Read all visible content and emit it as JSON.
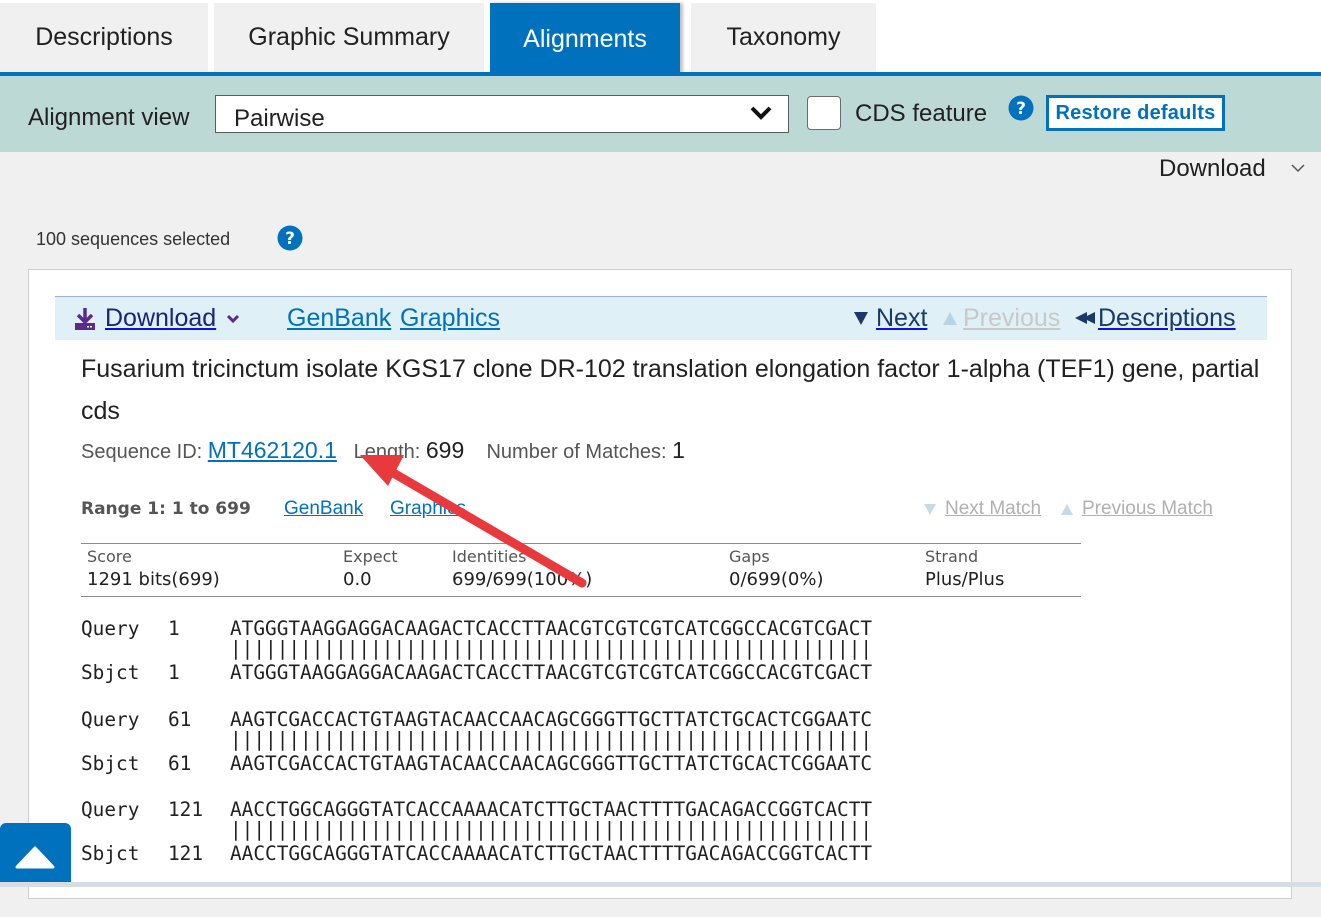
{
  "tabs": [
    {
      "label": "Descriptions",
      "active": false
    },
    {
      "label": "Graphic Summary",
      "active": false
    },
    {
      "label": "Alignments",
      "active": true
    },
    {
      "label": "Taxonomy",
      "active": false
    }
  ],
  "options": {
    "alignment_view_label": "Alignment view",
    "alignment_view_value": "Pairwise",
    "cds_feature_label": "CDS feature",
    "cds_feature_checked": false,
    "restore_defaults_label": "Restore defaults"
  },
  "download_top_label": "Download",
  "sequences_selected": "100 sequences selected",
  "hit": {
    "toolbar": {
      "download_label": "Download",
      "genbank_label": "GenBank",
      "graphics_label": "Graphics",
      "next_label": "Next",
      "previous_label": "Previous",
      "descriptions_label": "Descriptions"
    },
    "title": "Fusarium tricinctum isolate KGS17 clone DR-102 translation elongation factor 1-alpha (TEF1) gene, partial cds",
    "sequence_id_label": "Sequence ID:",
    "sequence_id": "MT462120.1",
    "length_label": "Length:",
    "length": "699",
    "matches_label": "Number of Matches:",
    "matches": "1",
    "range": {
      "label": "Range 1: 1 to 699",
      "genbank_label": "GenBank",
      "graphics_label": "Graphics",
      "next_match_label": "Next Match",
      "previous_match_label": "Previous Match"
    },
    "stats": {
      "headers": [
        "Score",
        "Expect",
        "Identities",
        "Gaps",
        "Strand"
      ],
      "values": [
        "1291 bits(699)",
        "0.0",
        "699/699(100%)",
        "0/699(0%)",
        "Plus/Plus"
      ]
    },
    "alignment": [
      {
        "query_label": "Query",
        "query_start": "1",
        "query_seq": "ATGGGTAAGGAGGACAAGACTCACCTTAACGTCGTCGTCATCGGCCACGTCGACT",
        "match": "|||||||||||||||||||||||||||||||||||||||||||||||||||||||",
        "sbjct_label": "Sbjct",
        "sbjct_start": "1",
        "sbjct_seq": "ATGGGTAAGGAGGACAAGACTCACCTTAACGTCGTCGTCATCGGCCACGTCGACT"
      },
      {
        "query_label": "Query",
        "query_start": "61",
        "query_seq": "AAGTCGACCACTGTAAGTACAACCAACAGCGGGTTGCTTATCTGCACTCGGAATC",
        "match": "|||||||||||||||||||||||||||||||||||||||||||||||||||||||",
        "sbjct_label": "Sbjct",
        "sbjct_start": "61",
        "sbjct_seq": "AAGTCGACCACTGTAAGTACAACCAACAGCGGGTTGCTTATCTGCACTCGGAATC"
      },
      {
        "query_label": "Query",
        "query_start": "121",
        "query_seq": "AACCTGGCAGGGTATCACCAAAACATCTTGCTAACTTTTGACAGACCGGTCACTT",
        "match": "|||||||||||||||||||||||||||||||||||||||||||||||||||||||",
        "sbjct_label": "Sbjct",
        "sbjct_start": "121",
        "sbjct_seq": "AACCTGGCAGGGTATCACCAAAACATCTTGCTAACTTTTGACAGACCGGTCACTT"
      }
    ]
  },
  "colors": {
    "accent": "#0071bc",
    "options_bar": "#bcd9d6",
    "toolbar_bg": "#e0f0f7",
    "annotation_arrow": "#e8393c"
  }
}
